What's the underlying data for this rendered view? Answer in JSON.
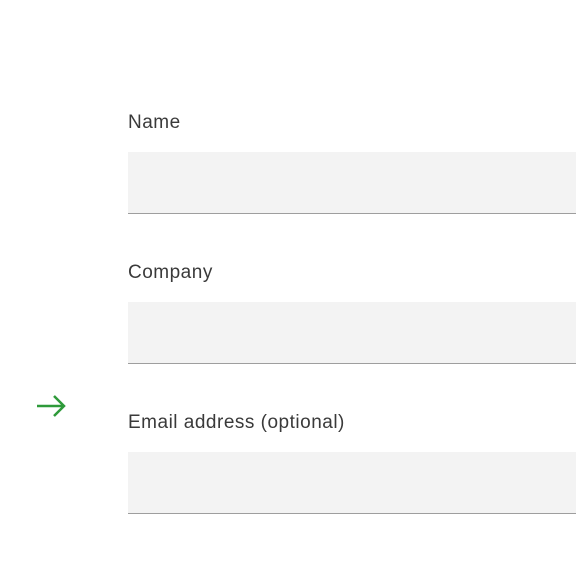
{
  "form": {
    "fields": [
      {
        "label": "Name",
        "value": ""
      },
      {
        "label": "Company",
        "value": ""
      },
      {
        "label": "Email address (optional)",
        "value": ""
      }
    ]
  },
  "accent_color": "#2e9a3a"
}
